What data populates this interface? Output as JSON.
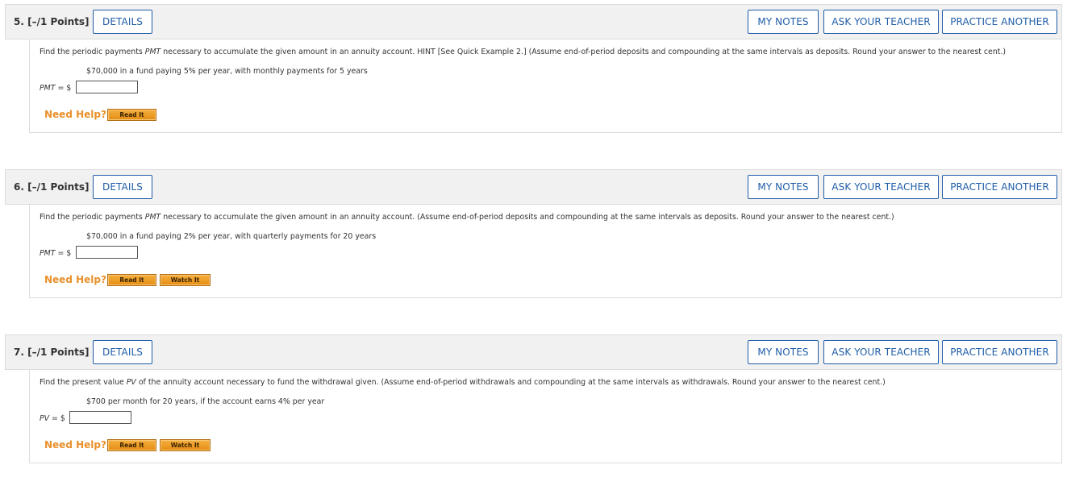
{
  "colors": {
    "header_bg": "#f1f1f1",
    "button_border": "#1f5da8",
    "need_help": "#e8902a",
    "help_button": "#f0a030"
  },
  "buttons": {
    "details": "DETAILS",
    "my_notes": "MY NOTES",
    "ask_teacher": "ASK YOUR TEACHER",
    "practice": "PRACTICE ANOTHER",
    "read_it": "Read It",
    "watch_it": "Watch It",
    "need_help": "Need Help?"
  },
  "questions": [
    {
      "number": "5.  [–/1 Points]",
      "prompt_before": "Find the periodic payments ",
      "prompt_var": "PMT",
      "prompt_after": " necessary to accumulate the given amount in an annuity account. HINT [See Quick Example 2.] (Assume end-of-period deposits and compounding at the same intervals as deposits. Round your answer to the nearest cent.)",
      "detail": "$70,000 in a fund paying 5% per year, with monthly payments for 5 years",
      "answer_var": "PMT",
      "answer_suffix": " = $",
      "answer_value": ""
    },
    {
      "number": "6.  [–/1 Points]",
      "prompt_before": "Find the periodic payments ",
      "prompt_var": "PMT",
      "prompt_after": " necessary to accumulate the given amount in an annuity account. (Assume end-of-period deposits and compounding at the same intervals as deposits. Round your answer to the nearest cent.)",
      "detail": "$70,000 in a fund paying 2% per year, with quarterly payments for 20 years",
      "answer_var": "PMT",
      "answer_suffix": " = $",
      "answer_value": ""
    },
    {
      "number": "7.  [–/1 Points]",
      "prompt_before": "Find the present value ",
      "prompt_var": "PV",
      "prompt_after": " of the annuity account necessary to fund the withdrawal given. (Assume end-of-period withdrawals and compounding at the same intervals as withdrawals. Round your answer to the nearest cent.)",
      "detail": "$700 per month for 20 years, if the account earns 4% per year",
      "answer_var": "PV",
      "answer_suffix": " = $",
      "answer_value": ""
    }
  ]
}
